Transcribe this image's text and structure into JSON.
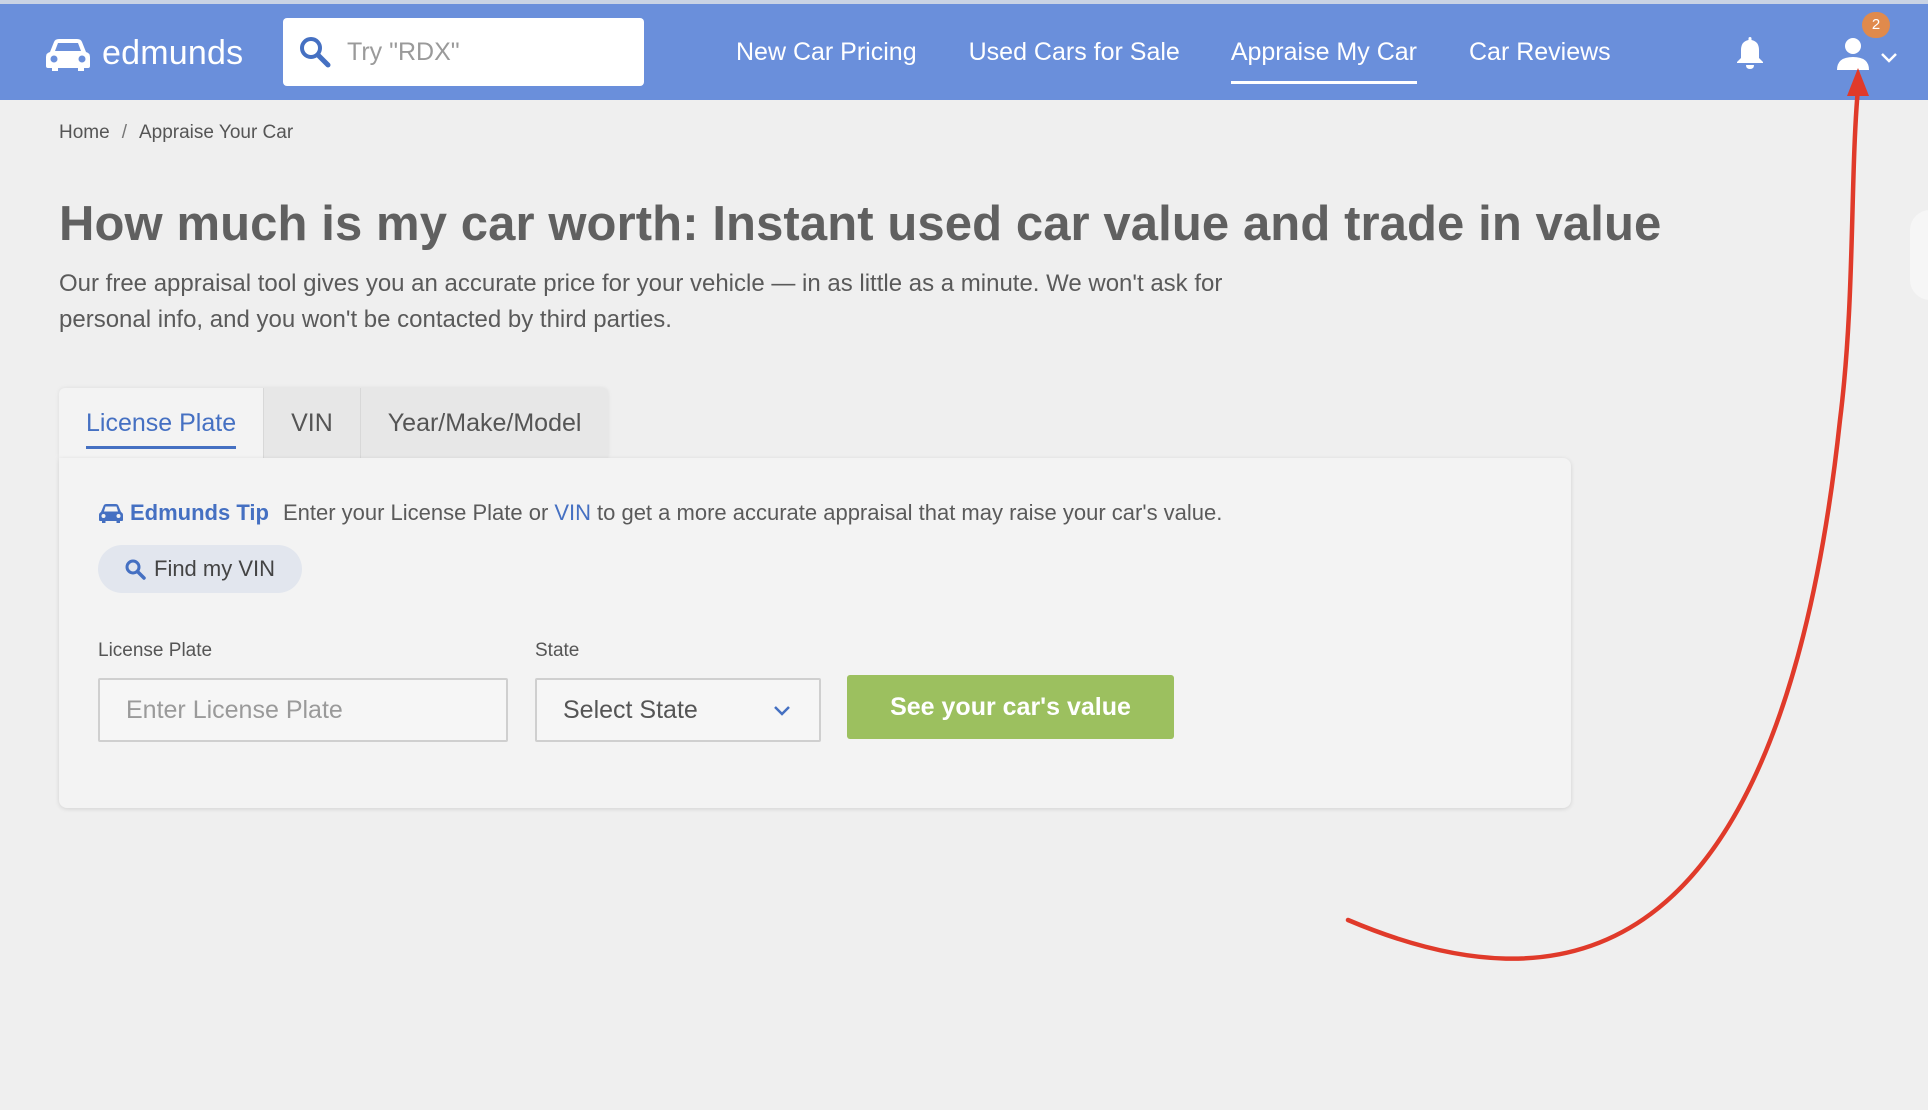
{
  "header": {
    "logo_text": "edmunds",
    "search_placeholder": "Try \"RDX\"",
    "nav": [
      {
        "label": "New Car Pricing"
      },
      {
        "label": "Used Cars for Sale"
      },
      {
        "label": "Appraise My Car",
        "active": true
      },
      {
        "label": "Car Reviews"
      }
    ],
    "notification_badge": "2",
    "icons": [
      "car-icon",
      "search-icon",
      "bell-icon",
      "user-icon",
      "chevron-down-icon"
    ]
  },
  "breadcrumb": {
    "home": "Home",
    "separator": "/",
    "current": "Appraise Your Car"
  },
  "main": {
    "title": "How much is my car worth: Instant used car value and trade in value",
    "description": "Our free appraisal tool gives you an accurate price for your vehicle — in as little as a minute. We won't ask for personal info, and you won't be contacted by third parties.",
    "tabs": [
      {
        "label": "License Plate",
        "active": true
      },
      {
        "label": "VIN"
      },
      {
        "label": "Year/Make/Model"
      }
    ],
    "tip": {
      "label": "Edmunds Tip",
      "text_before": "Enter your License Plate or",
      "link": "VIN",
      "text_after": "to get a more accurate appraisal that may raise your car's value."
    },
    "find_vin_label": "Find my VIN",
    "plate_label": "License Plate",
    "plate_placeholder": "Enter License Plate",
    "state_label": "State",
    "state_value": "Select State",
    "cta_label": "See your car's value"
  },
  "colors": {
    "header_bg": "#6a8fdb",
    "accent_blue": "#4570c2",
    "cta_green": "#9cc05f",
    "badge_orange": "#e08a4c",
    "annotation_red": "#e03a2a"
  }
}
